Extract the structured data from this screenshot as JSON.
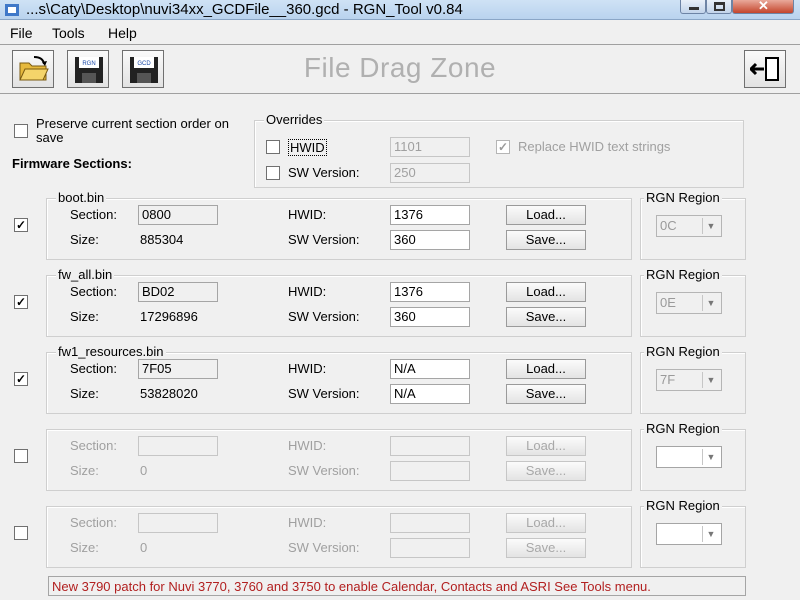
{
  "window": {
    "title": "...s\\Caty\\Desktop\\nuvi34xx_GCDFile__360.gcd - RGN_Tool v0.84"
  },
  "menu": [
    "File",
    "Tools",
    "Help"
  ],
  "toolbar": {
    "drag_zone": "File Drag Zone",
    "save_rgn_icon_text": "RGN",
    "save_gcd_icon_text": "GCD"
  },
  "options": {
    "preserve_order_label": "Preserve current section order on save",
    "preserve_checked": false,
    "firmware_sections_label": "Firmware Sections:"
  },
  "overrides": {
    "legend": "Overrides",
    "hwid_label": "HWID",
    "hwid_value": "1101",
    "sw_version_label": "SW Version:",
    "sw_version_value": "250",
    "replace_label": "Replace HWID text strings",
    "replace_checked": true
  },
  "labels": {
    "section": "Section:",
    "size": "Size:",
    "hwid": "HWID:",
    "sw_version": "SW Version:",
    "load": "Load...",
    "save": "Save...",
    "rgn_region": "RGN Region"
  },
  "sections": [
    {
      "name": "boot.bin",
      "checked": true,
      "section": "0800",
      "size": "885304",
      "hwid": "1376",
      "sw_version": "360",
      "region": "0C"
    },
    {
      "name": "fw_all.bin",
      "checked": true,
      "section": "BD02",
      "size": "17296896",
      "hwid": "1376",
      "sw_version": "360",
      "region": "0E"
    },
    {
      "name": "fw1_resources.bin",
      "checked": true,
      "section": "7F05",
      "size": "53828020",
      "hwid": "N/A",
      "sw_version": "N/A",
      "region": "7F"
    },
    {
      "name": "",
      "checked": false,
      "section": "",
      "size": "0",
      "hwid": "",
      "sw_version": "",
      "region": ""
    },
    {
      "name": "",
      "checked": false,
      "section": "",
      "size": "0",
      "hwid": "",
      "sw_version": "",
      "region": ""
    }
  ],
  "status": "New 3790 patch for Nuvi 3770, 3760 and 3750 to enable Calendar, Contacts and ASRI See Tools menu."
}
